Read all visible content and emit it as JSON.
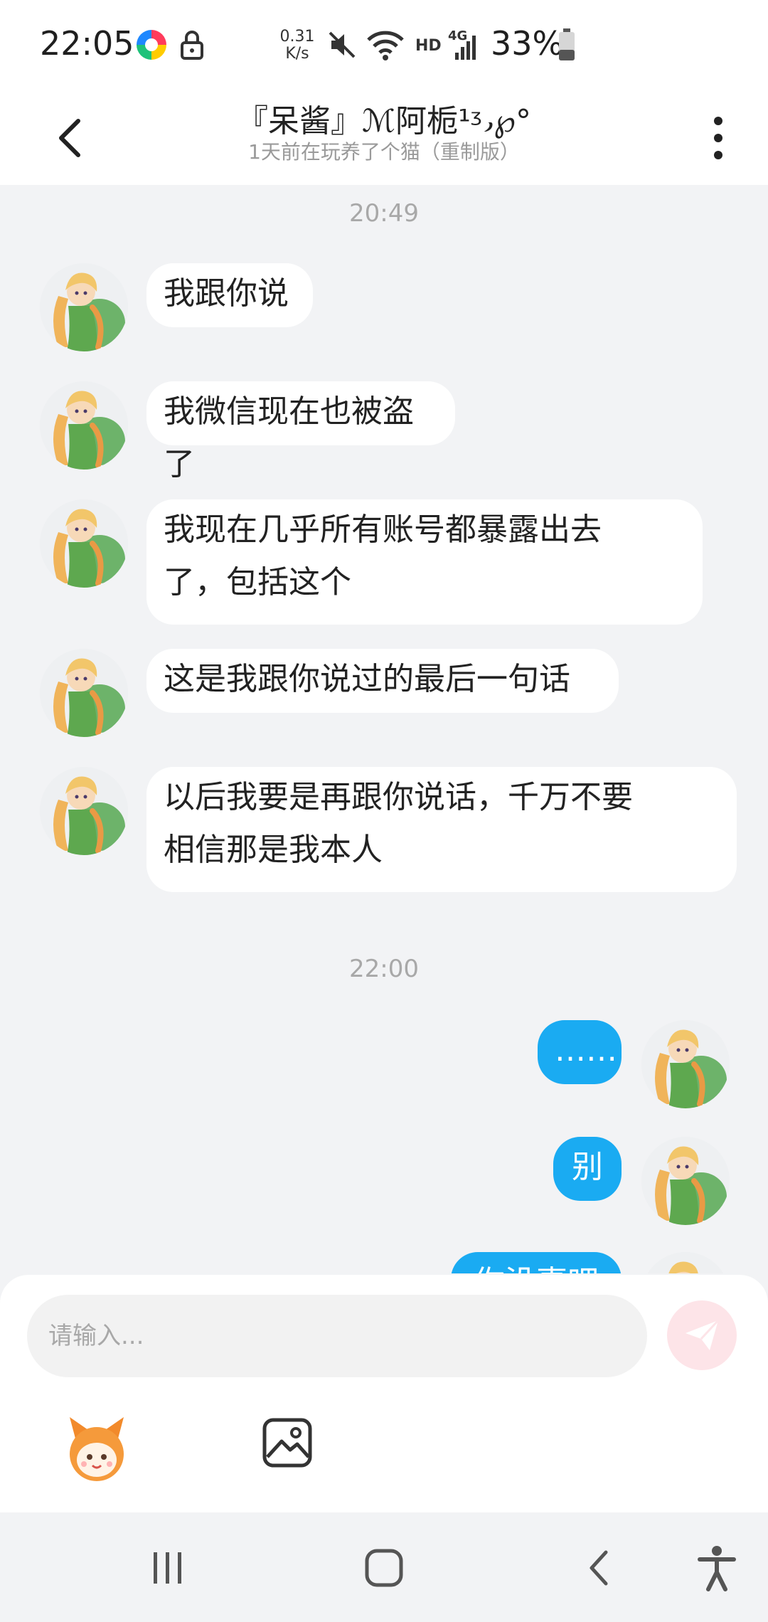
{
  "status_bar": {
    "time": "22:05",
    "net_speed_value": "0.31",
    "net_speed_unit": "K/s",
    "hd": "HD",
    "network": "4G",
    "battery": "33%",
    "icons": [
      "app-notification-icon",
      "lock-icon",
      "mute-icon",
      "wifi-icon",
      "signal-icon",
      "battery-icon"
    ]
  },
  "header": {
    "title": "『呆酱』ℳ阿栀¹ᶾ᎖℘°",
    "subtitle": "1天前在玩养了个猫（重制版）"
  },
  "messages": [
    {
      "type": "time",
      "text": "20:49"
    },
    {
      "type": "received",
      "lines": [
        "我跟你说"
      ]
    },
    {
      "type": "received",
      "lines": [
        "我微信现在也被盗了"
      ]
    },
    {
      "type": "received",
      "lines": [
        "我现在几乎所有账号都暴露出去",
        "了，包括这个"
      ]
    },
    {
      "type": "received",
      "lines": [
        "这是我跟你说过的最后一句话"
      ]
    },
    {
      "type": "received",
      "lines": [
        "以后我要是再跟你说话，千万不要",
        "相信那是我本人"
      ]
    },
    {
      "type": "time",
      "text": "22:00"
    },
    {
      "type": "sent",
      "lines": [
        "……"
      ]
    },
    {
      "type": "sent",
      "lines": [
        "别"
      ]
    },
    {
      "type": "sent",
      "lines": [
        "你没事吧"
      ]
    }
  ],
  "composer": {
    "placeholder": "请输入..."
  },
  "colors": {
    "sent_bubble": "#1aabf2",
    "received_bubble": "#ffffff",
    "send_button": "#fde4e8",
    "background": "#f2f3f5"
  }
}
